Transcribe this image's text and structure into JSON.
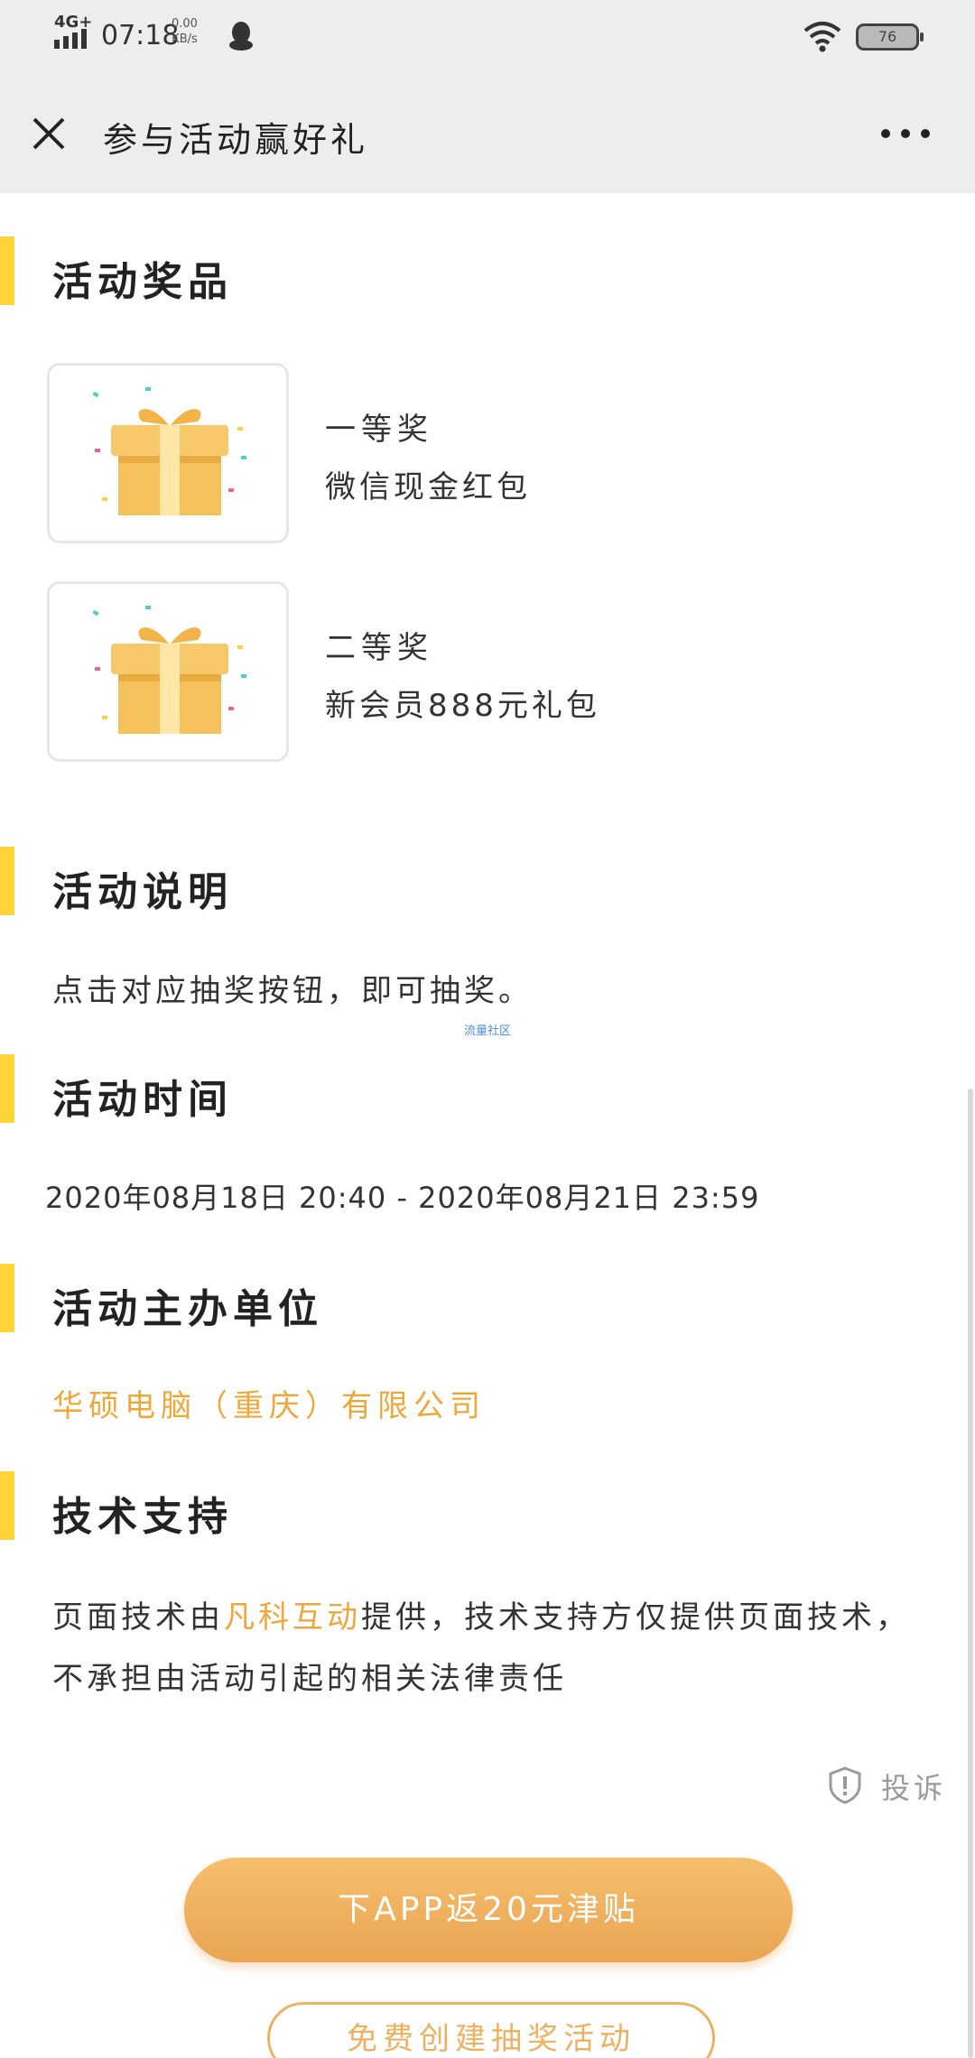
{
  "status_bar": {
    "network": "4G+",
    "time": "07:18",
    "speed_value": "0.00",
    "speed_unit": "KB/s",
    "battery": "76"
  },
  "title_bar": {
    "title": "参与活动赢好礼"
  },
  "sections": {
    "prizes": {
      "heading": "活动奖品"
    },
    "description": {
      "heading": "活动说明",
      "text": "点击对应抽奖按钮，即可抽奖。",
      "watermark": "流量社区"
    },
    "time": {
      "heading": "活动时间",
      "text": "2020年08月18日 20:40 - 2020年08月21日 23:59"
    },
    "organizer": {
      "heading": "活动主办单位",
      "name": "华硕电脑（重庆）有限公司"
    },
    "support": {
      "heading": "技术支持",
      "text_prefix": "页面技术由",
      "link": "凡科互动",
      "text_suffix": "提供，技术支持方仅提供页面技术，不承担由活动引起的相关法律责任"
    }
  },
  "prizes": [
    {
      "level": "一等奖",
      "name": "微信现金红包"
    },
    {
      "level": "二等奖",
      "name": "新会员888元礼包"
    }
  ],
  "report": {
    "label": "投诉"
  },
  "buttons": {
    "primary": "下APP返20元津贴",
    "secondary": "免费创建抽奖活动"
  },
  "colors": {
    "accent_yellow": "#ffd43a",
    "link_orange": "#f0a73a",
    "button_gradient_top": "#f6be6e",
    "button_gradient_bottom": "#e9a552",
    "header_bg": "#ededed"
  },
  "icons": [
    "signal-icon",
    "qq-icon",
    "wifi-icon",
    "battery-icon",
    "close-icon",
    "more-icon",
    "gift-box-icon",
    "shield-alert-icon"
  ]
}
